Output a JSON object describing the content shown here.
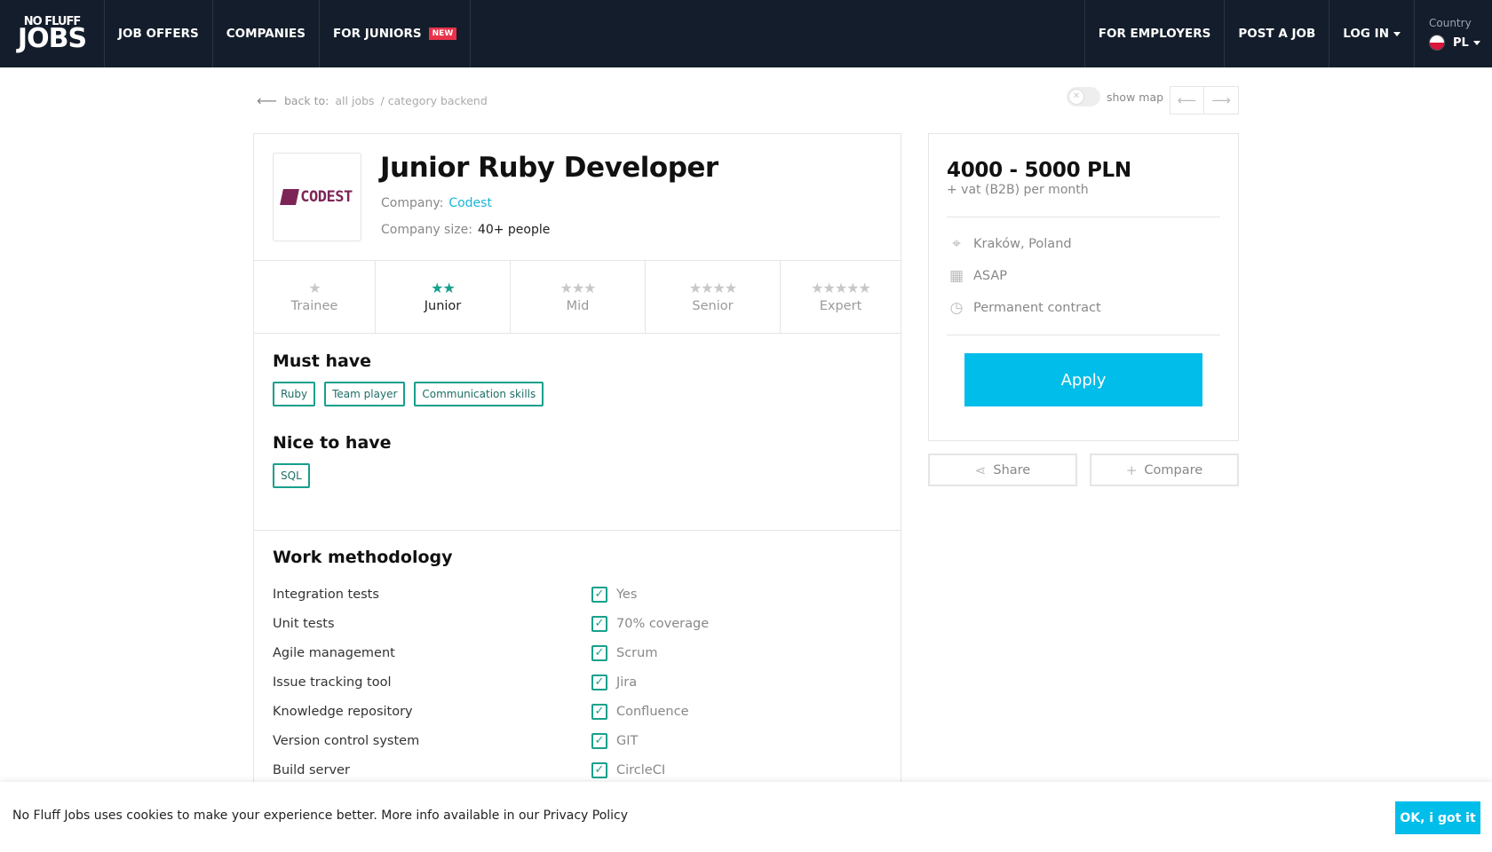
{
  "nav": {
    "logo_top": "NO FLUFF",
    "logo_bottom": "JOBS",
    "links": [
      "JOB OFFERS",
      "COMPANIES",
      "FOR JUNIORS"
    ],
    "new_badge": "NEW",
    "right_links": [
      "FOR EMPLOYERS",
      "POST A JOB",
      "LOG IN"
    ],
    "country_label": "Country",
    "country_value": "PL"
  },
  "breadcrumb": {
    "prefix": "back to:",
    "all_jobs": "all jobs",
    "category": "/ category backend"
  },
  "map": {
    "label": "show map"
  },
  "job": {
    "title": "Junior Ruby Developer",
    "company_label": "Company:",
    "company": "Codest",
    "company_logo_text": "CODEST",
    "size_label": "Company size:",
    "size": "40+ people"
  },
  "levels": [
    {
      "label": "Trainee",
      "stars": "★"
    },
    {
      "label": "Junior",
      "stars": "★★"
    },
    {
      "label": "Mid",
      "stars": "★★★"
    },
    {
      "label": "Senior",
      "stars": "★★★★"
    },
    {
      "label": "Expert",
      "stars": "★★★★★"
    }
  ],
  "must_have": {
    "title": "Must have",
    "tags": [
      "Ruby",
      "Team player",
      "Communication skills"
    ]
  },
  "nice_to_have": {
    "title": "Nice to have",
    "tags": [
      "SQL"
    ]
  },
  "methodology": {
    "title": "Work methodology",
    "rows": [
      {
        "key": "Integration tests",
        "value": "Yes"
      },
      {
        "key": "Unit tests",
        "value": "70% coverage"
      },
      {
        "key": "Agile management",
        "value": "Scrum"
      },
      {
        "key": "Issue tracking tool",
        "value": "Jira"
      },
      {
        "key": "Knowledge repository",
        "value": "Confluence"
      },
      {
        "key": "Version control system",
        "value": "GIT"
      },
      {
        "key": "Build server",
        "value": "CircleCI"
      }
    ]
  },
  "offer": {
    "salary": "4000 - 5000 PLN",
    "salary_sub": "+ vat (B2B) per month",
    "location": "Kraków, Poland",
    "start": "ASAP",
    "contract": "Permanent contract",
    "apply": "Apply",
    "share": "Share",
    "compare": "Compare"
  },
  "cookie": {
    "text": "No Fluff Jobs uses cookies to make your experience better. More info available in our Privacy Policy",
    "ok": "OK, i got it"
  },
  "colors": {
    "nav_bg": "#141d2b",
    "accent_cyan": "#00bde9",
    "accent_green": "#17a08c",
    "new_badge": "#e8334a",
    "company_brand": "#7d2456"
  }
}
